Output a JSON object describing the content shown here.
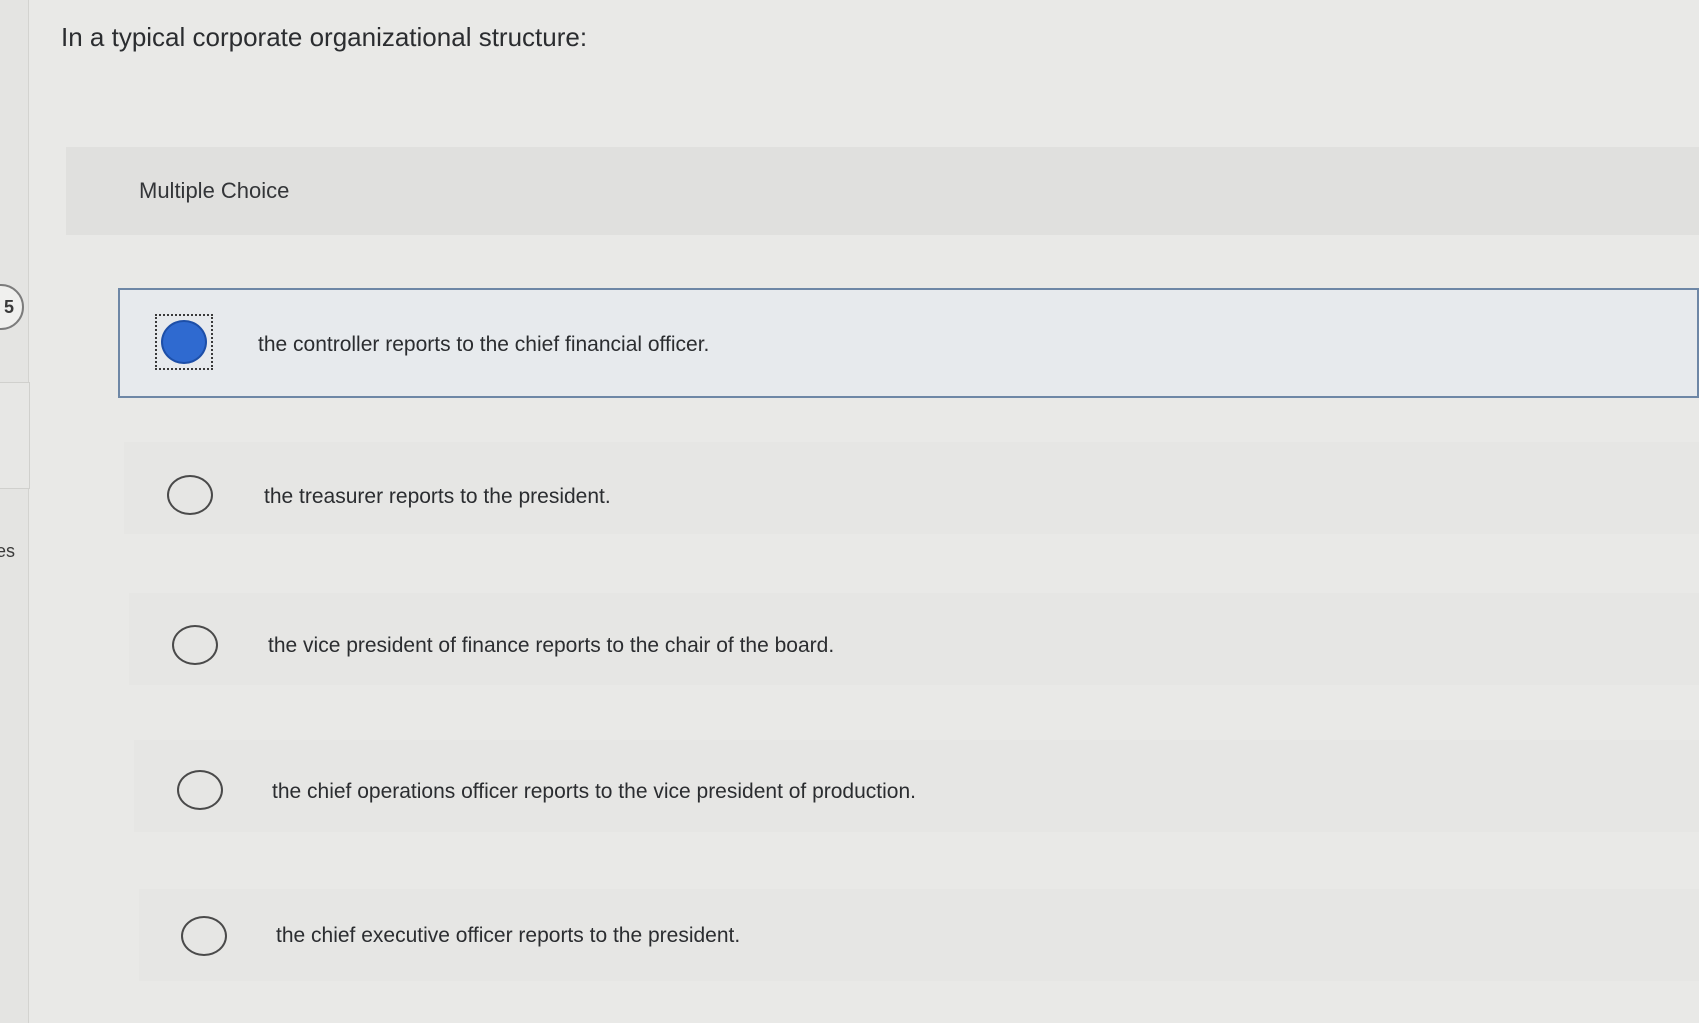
{
  "sidebar": {
    "question_number": "5",
    "side_label": "es"
  },
  "question": {
    "text": "In a typical corporate organizational structure:",
    "type_label": "Multiple Choice"
  },
  "choices": [
    {
      "text": "the controller reports to the chief financial officer.",
      "selected": true
    },
    {
      "text": "the treasurer reports to the president.",
      "selected": false
    },
    {
      "text": "the vice president of finance reports to the chair of the board.",
      "selected": false
    },
    {
      "text": "the chief operations officer reports to the vice president of production.",
      "selected": false
    },
    {
      "text": "the chief executive officer reports to the president.",
      "selected": false
    }
  ],
  "colors": {
    "selected_fill": "#2f6ad0",
    "selected_border": "#6e87a6"
  }
}
